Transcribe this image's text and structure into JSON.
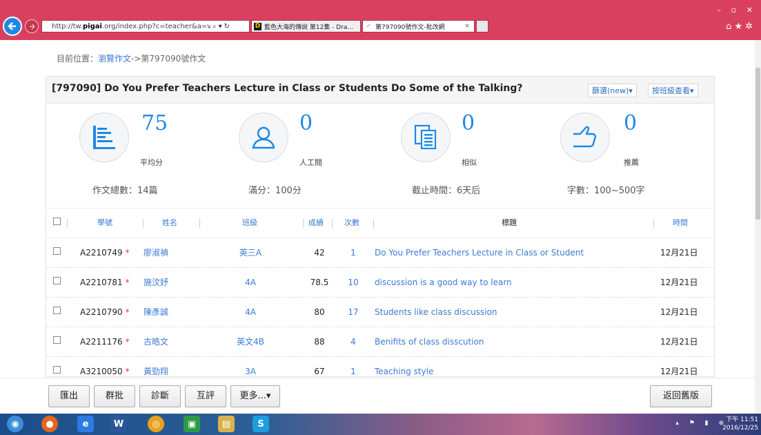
{
  "browser": {
    "url": "http://tw.pigai.org/index.php?c=teacher&a=view&",
    "url_host_bold": "pigai",
    "tabs": [
      {
        "label": "藍色大海的傳說 第12集 - Dra...",
        "favicon": "D"
      },
      {
        "label": "第797090號作文-批改網",
        "favicon": "✓"
      }
    ],
    "colors": {
      "chrome": "#d9405f",
      "accent": "#1e88e5"
    }
  },
  "breadcrumb": {
    "prefix": "目前位置：",
    "link": "瀏覽作文",
    "suffix": "->第797090號作文"
  },
  "panel": {
    "title": "[797090] Do You Prefer Teachers Lecture in Class or Students Do Some of the Talking?",
    "filter_label": "篩選(new)▾",
    "class_view_label": "按班級查看▾"
  },
  "stats": [
    {
      "icon": "document-list-icon",
      "value": "75",
      "caption": "平均分"
    },
    {
      "icon": "person-icon",
      "value": "0",
      "caption": "人工閱"
    },
    {
      "icon": "documents-copy-icon",
      "value": "0",
      "caption": "相似"
    },
    {
      "icon": "thumbs-up-icon",
      "value": "0",
      "caption": "推薦"
    }
  ],
  "info": {
    "total": "作文總數：14篇",
    "full_score": "滿分：100分",
    "deadline": "截止時間：6天后",
    "word_count": "字數：100~500字"
  },
  "table": {
    "headers": {
      "id": "學號",
      "name": "姓名",
      "class": "班級",
      "score": "成績",
      "count": "次數",
      "title": "標題",
      "time": "時間"
    },
    "rows": [
      {
        "id": "A2210749",
        "name": "廖淑禎",
        "class": "英三A",
        "score": "42",
        "count": "1",
        "title": "Do You Prefer Teachers Lecture in Class or Student",
        "time": "12月21日"
      },
      {
        "id": "A2210781",
        "name": "施汶妤",
        "class": "4A",
        "score": "78.5",
        "count": "10",
        "title": "discussion is a good way to learn",
        "time": "12月21日"
      },
      {
        "id": "A2210790",
        "name": "陳彥誠",
        "class": "4A",
        "score": "80",
        "count": "17",
        "title": "Students like class discussion",
        "time": "12月21日"
      },
      {
        "id": "A2211176",
        "name": "古皓文",
        "class": "英文4B",
        "score": "88",
        "count": "4",
        "title": "Benifits of class disscution",
        "time": "12月21日"
      },
      {
        "id": "A3210050",
        "name": "黃勁翔",
        "class": "3A",
        "score": "67",
        "count": "1",
        "title": "Teaching style",
        "time": "12月21日"
      }
    ]
  },
  "toolbar": {
    "export": "匯出",
    "batch": "群批",
    "diagnose": "診斷",
    "peer_review": "互評",
    "more": "更多...▾",
    "back_old": "返回舊版"
  },
  "taskbar": {
    "time": "下午 11:51",
    "date": "2016/12/25"
  }
}
